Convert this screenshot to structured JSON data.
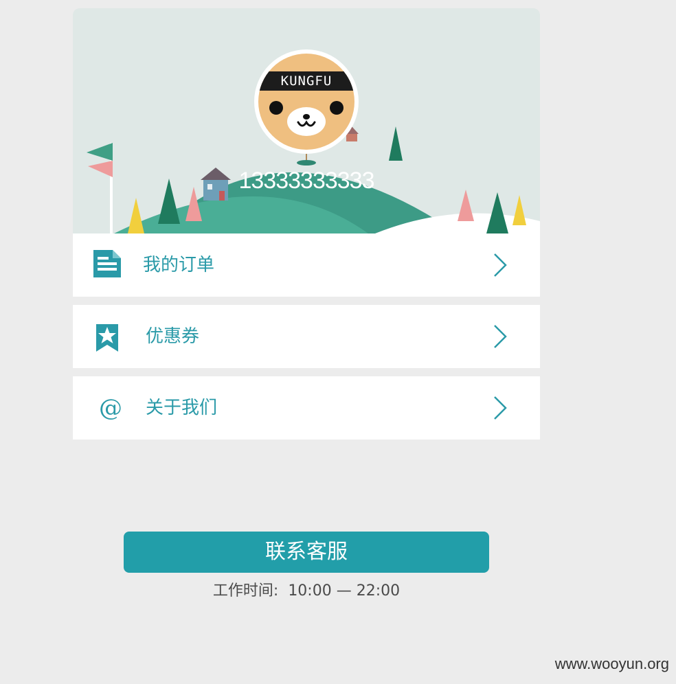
{
  "profile": {
    "phone": "13333333333",
    "avatar_headband_text": "KUNGFU"
  },
  "menu": [
    {
      "label": "我的订单",
      "icon": "document-icon"
    },
    {
      "label": "优惠券",
      "icon": "coupon-star-icon"
    },
    {
      "label": "关于我们",
      "icon": "at-icon",
      "glyph": "@"
    }
  ],
  "contact": {
    "button_label": "联系客服",
    "hours_label": "工作时间:",
    "hours_value": "10:00 — 22:00"
  },
  "watermark": "www.wooyun.org",
  "colors": {
    "accent": "#229ea9",
    "banner_bg": "#dfe8e6",
    "hill_green": "#3d9b86",
    "page_bg": "#ececec"
  }
}
